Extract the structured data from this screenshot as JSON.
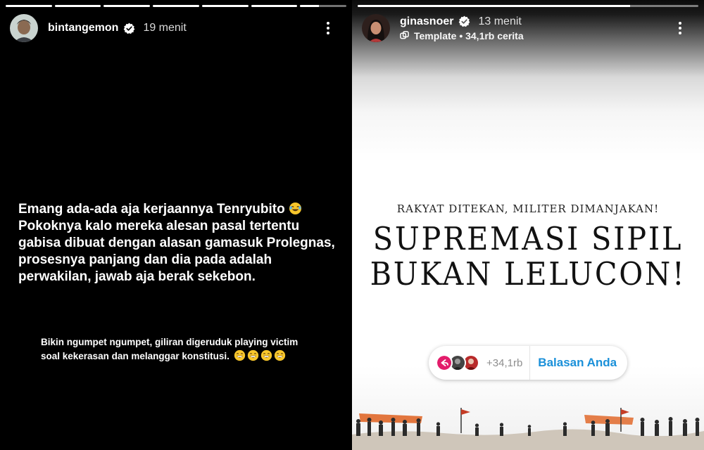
{
  "left_story": {
    "username": "bintangemon",
    "time": "19 menit",
    "progress": [
      1,
      1,
      1,
      1,
      1,
      1,
      0.4
    ],
    "main_lines": [
      "Emang ada-ada aja kerjaannya Tenryubito",
      "Pokoknya kalo mereka alesan pasal tertentu",
      "gabisa dibuat dengan alasan gamasuk Prolegnas,",
      "prosesnya panjang dan dia pada adalah",
      "perwakilan, jawab aja berak sekebon."
    ],
    "sub_lines": [
      "Bikin ngumpet ngumpet, giliran digeruduk playing victim",
      "soal kekerasan dan melanggar konstitusi."
    ]
  },
  "right_story": {
    "username": "ginasnoer",
    "time": "13 menit",
    "template_label": "Template • 34,1rb cerita",
    "progress": [
      0.8
    ],
    "poster": {
      "line1": "Rakyat ditekan, militer dimanjakan!",
      "line2": "SUPREMASI SIPIL",
      "line3": "BUKAN LELUCON!"
    },
    "reply_count": "+34,1rb",
    "reply_label": "Balasan Anda"
  },
  "colors": {
    "reply_blue": "#1a90d9",
    "verified_blue": "#ffffff",
    "protest_orange": "#e0682a"
  },
  "icons": [
    "verified-icon",
    "more-options-icon",
    "template-icon",
    "laughing-emoji-icon",
    "grinning-emoji-icon",
    "reply-icon"
  ]
}
